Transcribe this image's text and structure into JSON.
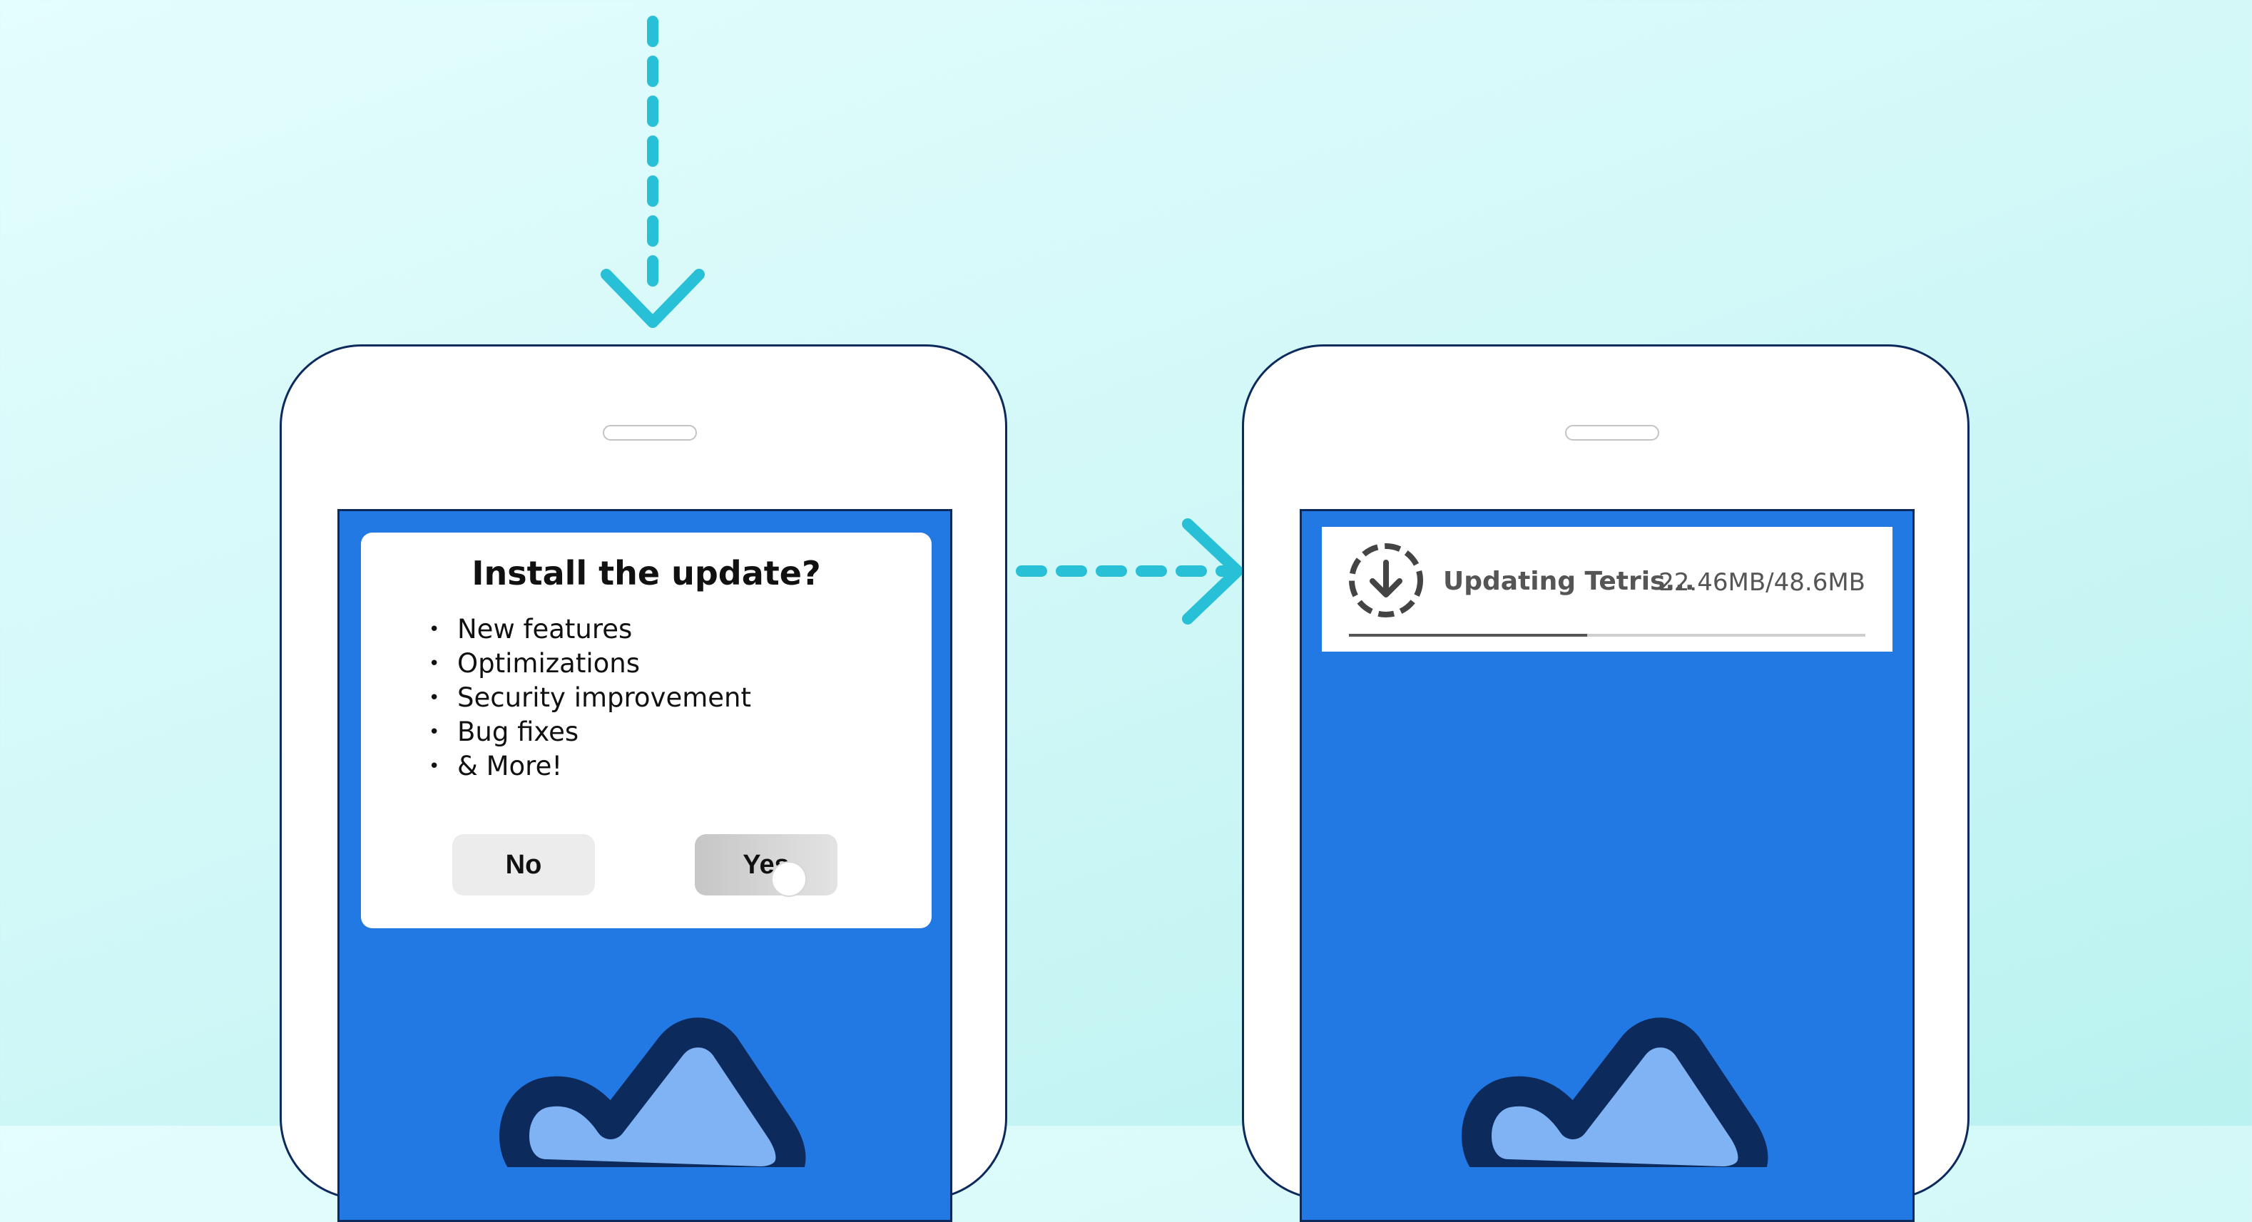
{
  "colors": {
    "accent": "#27c0d6",
    "screen": "#2279e3",
    "cloud_outline": "#0d2a5c",
    "cloud_fill": "#7fb3f3"
  },
  "dialog": {
    "title": "Install the update?",
    "items": [
      "New features",
      "Optimizations",
      "Security improvement",
      "Bug fixes",
      "& More!"
    ],
    "no_label": "No",
    "yes_label": "Yes"
  },
  "notification": {
    "icon": "download-icon",
    "title": "Updating Tetris...",
    "downloaded": "22.46MB/48.6MB",
    "progress": 0.462
  }
}
